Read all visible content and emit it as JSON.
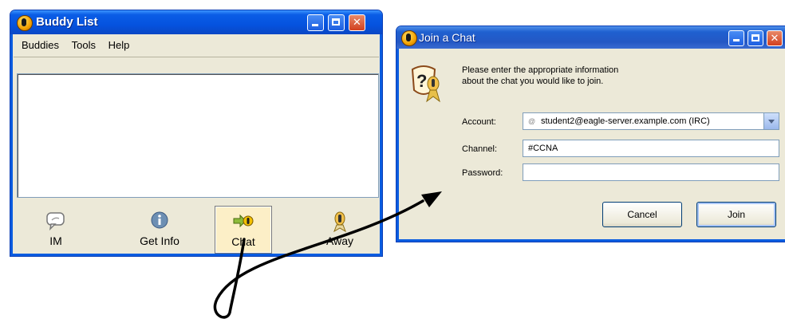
{
  "buddy_list": {
    "title": "Buddy List",
    "menu": [
      "Buddies",
      "Tools",
      "Help"
    ],
    "toolbar": [
      {
        "label": "IM",
        "icon": "im-bubble-icon"
      },
      {
        "label": "Get Info",
        "icon": "info-icon"
      },
      {
        "label": "Chat",
        "icon": "chat-icon",
        "active": true
      },
      {
        "label": "Away",
        "icon": "away-icon"
      }
    ]
  },
  "join_chat": {
    "title": "Join a Chat",
    "instructions_line1": "Please enter the appropriate information",
    "instructions_line2": "about the chat you would like to join.",
    "account_label": "Account:",
    "account_value": "student2@eagle-server.example.com (IRC)",
    "channel_label": "Channel:",
    "channel_value": "#CCNA",
    "password_label": "Password:",
    "password_value": "",
    "cancel_label": "Cancel",
    "join_label": "Join"
  },
  "colors": {
    "titlebar": "#0a5de6",
    "window_face": "#ece9d8",
    "close_button": "#d2401f"
  }
}
